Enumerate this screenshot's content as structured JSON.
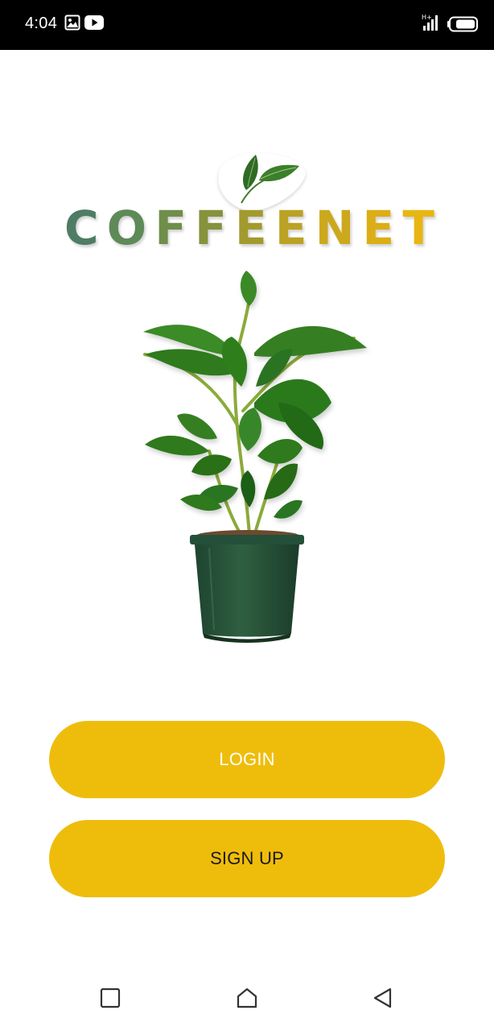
{
  "status_bar": {
    "time": "4:04",
    "icons": [
      "gallery-icon",
      "youtube-icon",
      "signal-icon",
      "battery-icon"
    ]
  },
  "logo": {
    "letters": [
      {
        "char": "C",
        "color": "#4E7C64"
      },
      {
        "char": "O",
        "color": "#5E8A58"
      },
      {
        "char": "F",
        "color": "#6F8E4A"
      },
      {
        "char": "F",
        "color": "#86923C"
      },
      {
        "char": "E",
        "color": "#A39A2E"
      },
      {
        "char": "E",
        "color": "#BBA224"
      },
      {
        "char": "N",
        "color": "#CCA81C"
      },
      {
        "char": "E",
        "color": "#DCAE16"
      },
      {
        "char": "T",
        "color": "#E8B612"
      }
    ],
    "text": "COFFEENET"
  },
  "buttons": {
    "login_label": "LOGIN",
    "signup_label": "SIGN UP"
  },
  "colors": {
    "button_fill": "#EEBD0C",
    "leaf_green": "#2E7A22",
    "pot_green": "#2C5A3A"
  },
  "nav_bar": {
    "icons": [
      "recent-apps-icon",
      "home-icon",
      "back-icon"
    ]
  }
}
